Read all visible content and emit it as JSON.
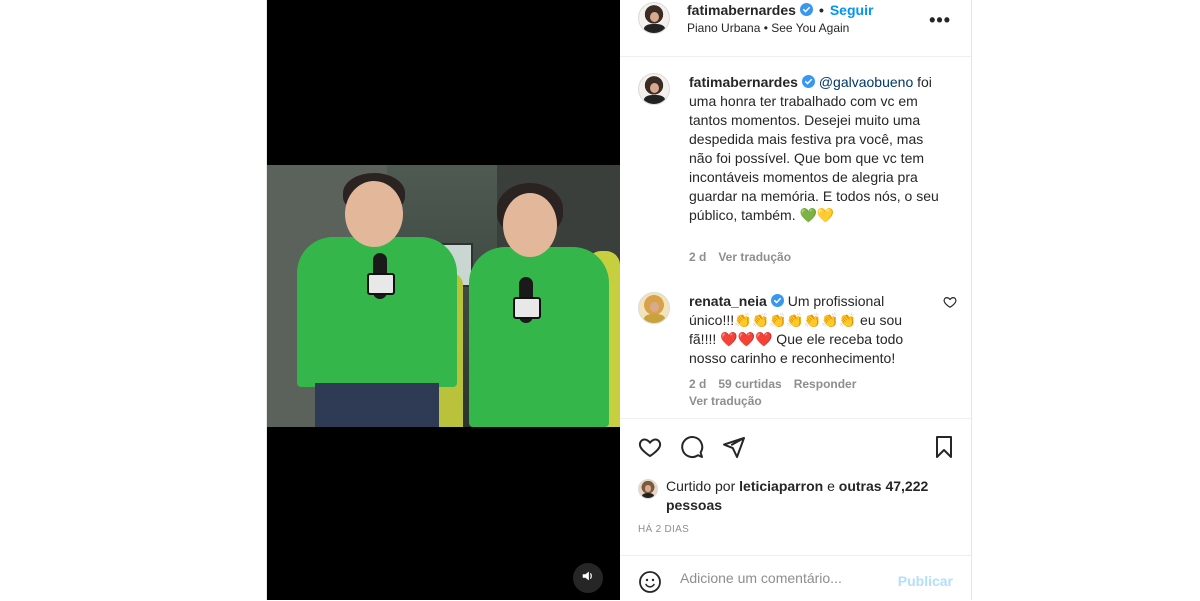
{
  "post": {
    "header": {
      "username": "fatimabernardes",
      "follow_label": "Seguir",
      "dot": "•",
      "music": "Piano Urbana • See You Again",
      "more_label": "•••"
    },
    "caption": {
      "username": "fatimabernardes",
      "mention": "@galvaobueno",
      "text": "foi uma honra ter trabalhado com vc em tantos momentos. Desejei muito uma despedida mais festiva pra você, mas não foi possível. Que bom que vc tem incontáveis momentos de alegria pra guardar na memória. E todos nós, o seu público, também. 💚💛",
      "time": "2 d",
      "translate": "Ver tradução"
    },
    "comments": [
      {
        "username": "renata_neia",
        "text": "Um profissional único!!!👏👏👏👏👏👏👏 eu sou fã!!!! ❤️❤️❤️ Que ele receba todo nosso carinho e reconhecimento!",
        "time": "2 d",
        "likes": "59 curtidas",
        "reply": "Responder",
        "translate": "Ver tradução"
      }
    ],
    "likes": {
      "prefix": "Curtido por",
      "user": "leticiaparron",
      "and": "e",
      "others": "outras 47,222 pessoas"
    },
    "timestamp": "HÁ 2 DIAS",
    "add_comment": {
      "placeholder": "Adicione um comentário...",
      "publish_label": "Publicar"
    }
  },
  "colors": {
    "accent": "#0095f6",
    "verified": "#3897f0",
    "publish_disabled": "#b2dffc",
    "muted": "#8e8e8e",
    "text": "#262626"
  },
  "icons": [
    "verified-icon",
    "more-icon",
    "heart-icon",
    "comment-icon",
    "share-icon",
    "bookmark-icon",
    "emoji-icon",
    "audio-icon"
  ]
}
